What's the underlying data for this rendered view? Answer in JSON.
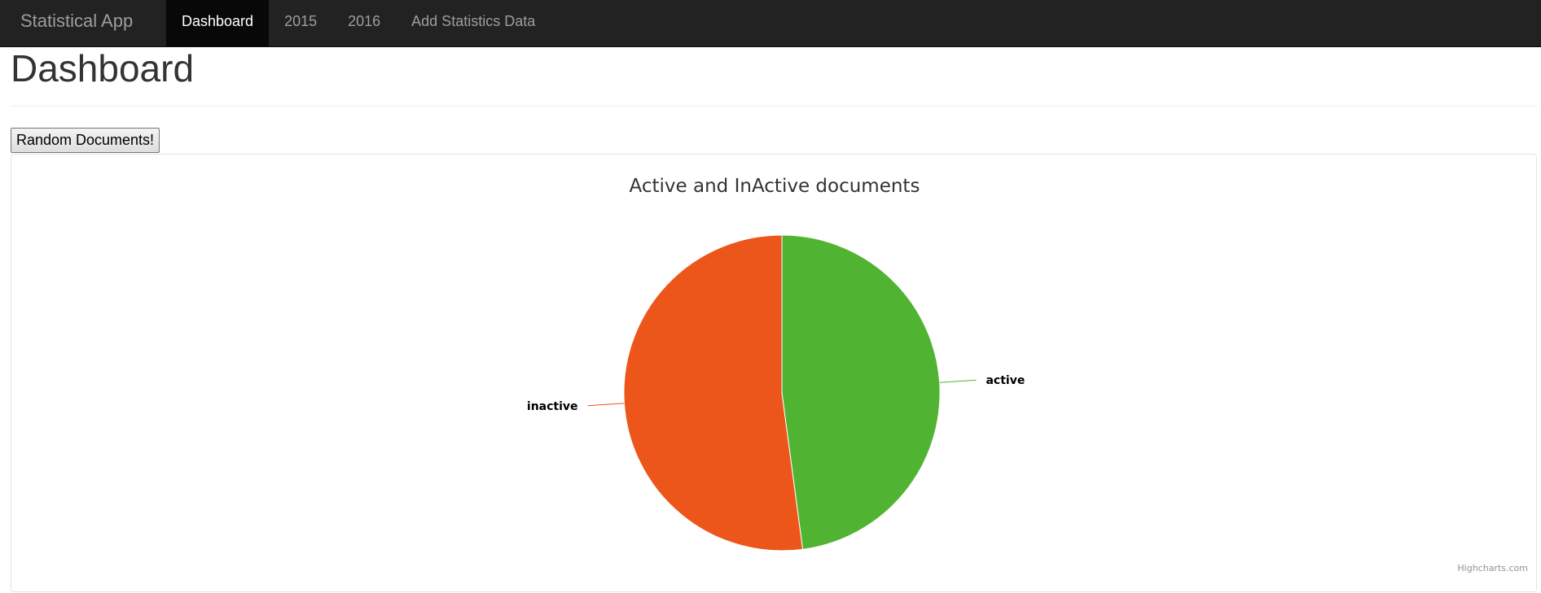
{
  "app": {
    "brand": "Statistical App"
  },
  "nav": {
    "items": [
      {
        "label": "Dashboard",
        "active": true
      },
      {
        "label": "2015",
        "active": false
      },
      {
        "label": "2016",
        "active": false
      },
      {
        "label": "Add Statistics Data",
        "active": false
      }
    ]
  },
  "page": {
    "title": "Dashboard"
  },
  "actions": {
    "random_label": "Random Documents!"
  },
  "chart_data": {
    "type": "pie",
    "title": "Active and InActive documents",
    "slices": [
      {
        "name": "active",
        "value": 47.9,
        "color": "#50b432"
      },
      {
        "name": "inactive",
        "value": 52.1,
        "color": "#ed561b"
      }
    ],
    "credits": "Highcharts.com"
  }
}
